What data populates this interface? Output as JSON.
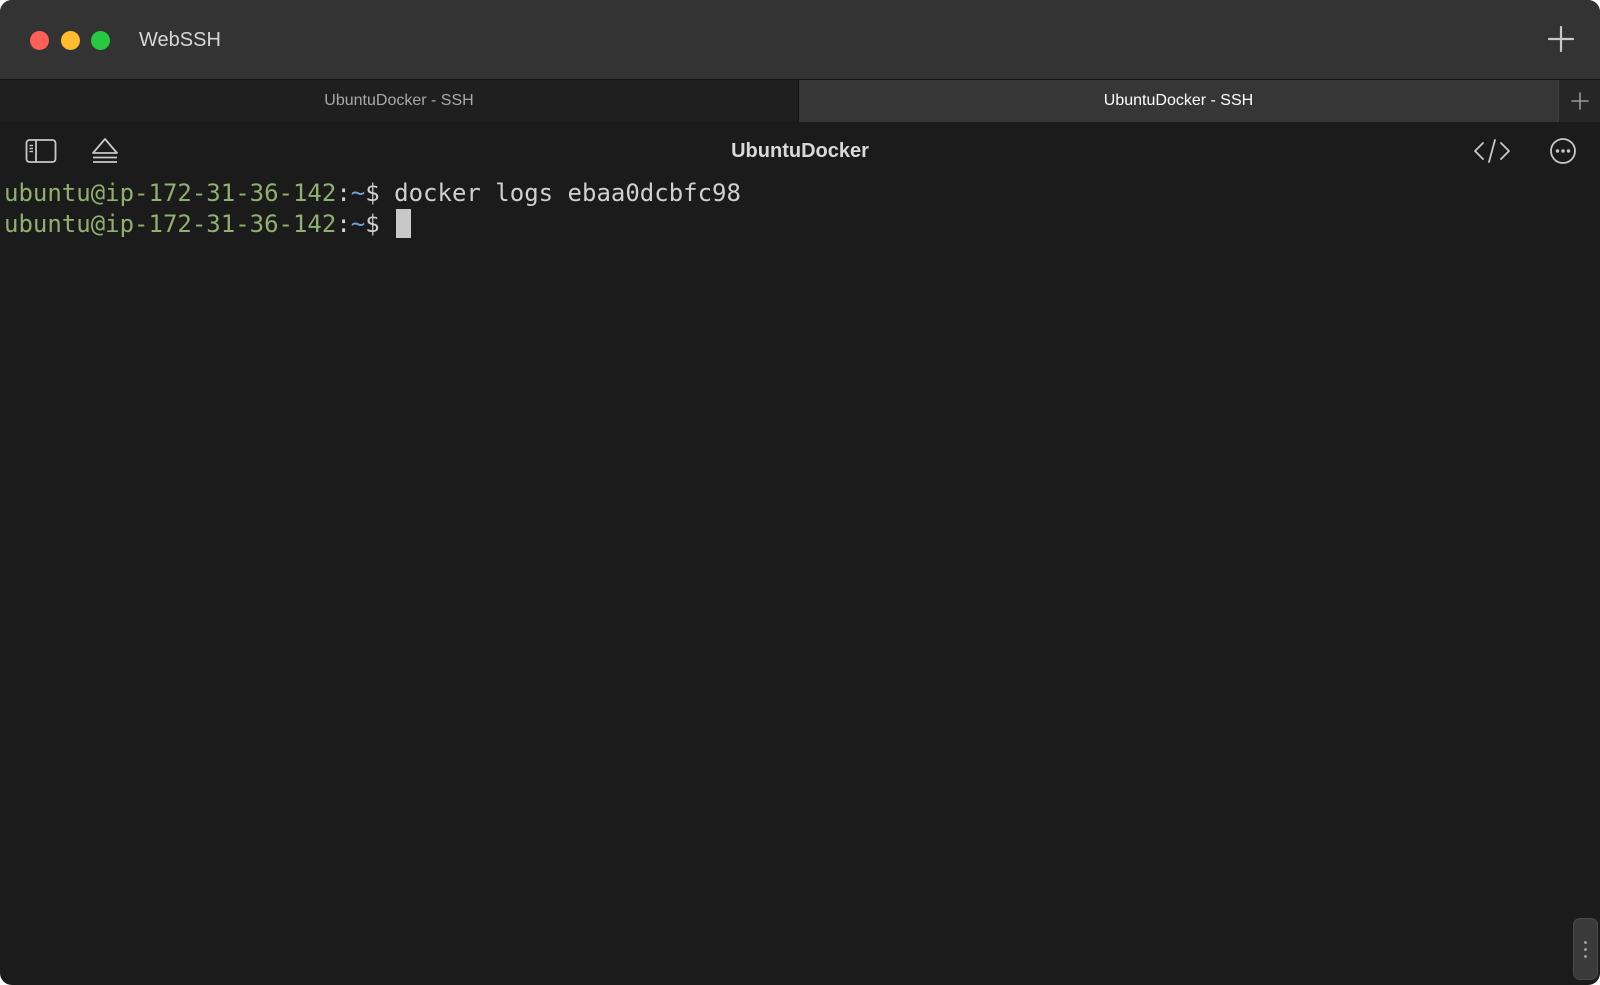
{
  "window": {
    "app_title": "WebSSH"
  },
  "tabs": [
    {
      "label": "UbuntuDocker - SSH",
      "active": false
    },
    {
      "label": "UbuntuDocker - SSH",
      "active": true
    }
  ],
  "toolbar": {
    "host_title": "UbuntuDocker",
    "icons": [
      "sidebar-icon",
      "eject-icon",
      "code-icon",
      "more-icon"
    ]
  },
  "terminal": {
    "lines": [
      {
        "user_host": "ubuntu@ip-172-31-36-142",
        "colon": ":",
        "path": "~",
        "dollar": "$",
        "command": " docker logs ebaa0dcbfc98"
      },
      {
        "user_host": "ubuntu@ip-172-31-36-142",
        "colon": ":",
        "path": "~",
        "dollar": "$",
        "command": " "
      }
    ]
  },
  "colors": {
    "prompt_user": "#8fb06e",
    "prompt_path": "#6fa3d6",
    "terminal_bg": "#1b1b1b",
    "close": "#ff5f57",
    "minimize": "#febc2e",
    "zoom": "#28c840"
  }
}
